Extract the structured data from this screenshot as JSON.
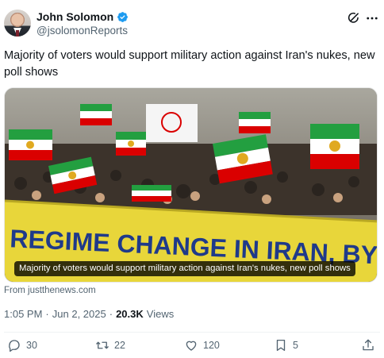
{
  "author": {
    "display_name": "John Solomon",
    "handle": "@jsolomonReports"
  },
  "header_icons": [
    "verified-badge-icon",
    "grok-icon",
    "more-icon"
  ],
  "tweet": {
    "text": "Majority of voters would support military action against Iran's nukes, new poll shows"
  },
  "media": {
    "banner_text": "REGIME CHANGE IN IRAN, BY THE",
    "caption": "Majority of voters would support military action against Iran's nukes, new poll shows"
  },
  "link_source": "From justthenews.com",
  "meta": {
    "time": "1:05 PM",
    "separator": "·",
    "date": "Jun 2, 2025",
    "views_count": "20.3K",
    "views_label": "Views"
  },
  "actions": {
    "replies": "30",
    "reposts": "22",
    "likes": "120",
    "bookmarks": "5"
  },
  "colors": {
    "verified": "#1d9bf0",
    "muted": "#536471",
    "text": "#0f1419",
    "banner_yellow": "#e8d63a",
    "banner_blue": "#1f3a8a"
  }
}
